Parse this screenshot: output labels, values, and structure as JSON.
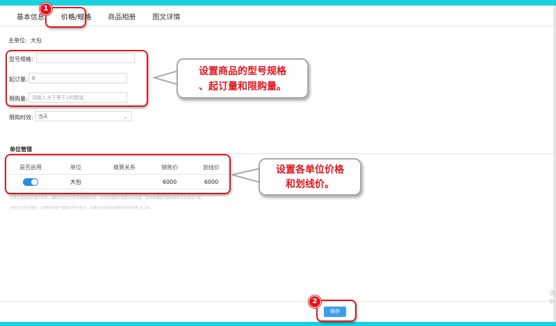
{
  "tabs": [
    "基本信息",
    "价格/规格",
    "商品相册",
    "图文详情"
  ],
  "form": {
    "main_unit_label": "主单位:",
    "main_unit_value": "大包",
    "model_spec_label": "型号规格:",
    "model_spec_value": "",
    "min_order_label": "起订量:",
    "min_order_value": "0",
    "limit_label": "限购量:",
    "limit_placeholder": "请输入大于等于1的数值",
    "limit_period_label": "限购时效:",
    "limit_period_value": "当天"
  },
  "units_section": {
    "title": "单位管理",
    "columns": [
      "是否启用",
      "单位",
      "换算关系",
      "销售价",
      "划线价"
    ],
    "rows": [
      {
        "enabled": true,
        "unit": "大包",
        "conversion": "",
        "sale_price": "6000",
        "list_price": "6000"
      }
    ]
  },
  "notes": [
    "主单位是商品的最小单位，辅助单位与主单位的换算关系，单位的销售价需要在此设置，系统将根据设置的换算关系自动计算。",
    "划线价只作为展示，如划线价低于销售价则不显示，设置后在商品页面展示划线价格 ￥120。"
  ],
  "save_label": "保存",
  "annotations": {
    "badge_1": "1",
    "badge_2": "2",
    "callout_1": "设置商品的型号规格\n、起订量和限购量。",
    "callout_2": "设置各单位价格\n和划线价。"
  },
  "side_ghost": [
    "满",
    "到"
  ],
  "colors": {
    "accent": "#1bd1e0",
    "annotation_red": "#e0161f",
    "button_blue": "#3d9ef0",
    "toggle_blue": "#2b8ae6"
  }
}
